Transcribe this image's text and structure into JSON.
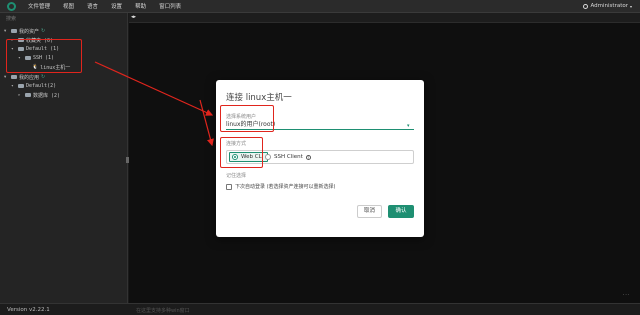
{
  "menubar": {
    "items": [
      "文件管理",
      "视图",
      "语言",
      "设置",
      "帮助",
      "窗口列表"
    ],
    "user": "Administrator"
  },
  "sidebar": {
    "search_placeholder": "搜索",
    "tree": {
      "my_assets": "我的资产",
      "favorites": "收藏夹 (0)",
      "default": "Default (1)",
      "ssh": "SSH (1)",
      "host": "linux主机一",
      "my_apps": "我的应用",
      "default2": "Default(2)",
      "database": "数据库 (2)"
    }
  },
  "footer": {
    "version": "Version v2.22.1",
    "hint": "在这里支持多种win窗口"
  },
  "watermark": "...",
  "modal": {
    "title": "连接 linux主机一",
    "system_user_label": "选择系统用户",
    "system_user_value": "linux的用户(root)",
    "connect_method_label": "连接方式",
    "option_webcli": "Web CLI",
    "option_sshclient": "SSH Client",
    "remember_label": "记住选择",
    "auto_login": "下次自动登录 (若选择资产连接可以重新选择)",
    "cancel": "取消",
    "confirm": "确认"
  },
  "colors": {
    "accent": "#1e8f72",
    "annotation": "#e0251d"
  }
}
